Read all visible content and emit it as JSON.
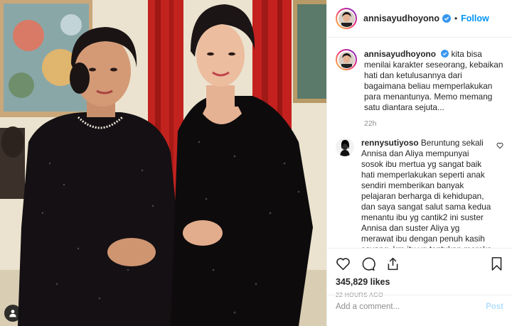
{
  "post": {
    "author": "annisayudhoyono",
    "follow_label": "Follow",
    "separator": "•"
  },
  "caption": {
    "author": "annisayudhoyono",
    "text": "kita bisa menilai karakter seseorang, kebaikan hati dan ketulusannya dari bagaimana beliau memperlakukan para menantunya. Memo memang satu diantara sejuta...",
    "time": "22h"
  },
  "comments": [
    {
      "author": "rennysutiyoso",
      "text": "Beruntung sekali Annisa dan Aliya mempunyai sosok ibu mertua yg sangat baik hati memperlakukan seperti anak sendiri memberikan banyak pelajaran berharga di kehidupan, dan saya sangat salut sama kedua menantu ibu yg cantik2 ini suster Annisa dan suster Aliya yg merawat ibu dengan penuh kasih sayang, krn itu yg tentukan mereka dapatkan dari ibu ani"
    }
  ],
  "stats": {
    "likes": "345,829 likes",
    "time_ago": "22 HOURS AGO"
  },
  "add_comment": {
    "placeholder": "Add a comment...",
    "post_label": "Post"
  },
  "icons": {
    "verified": "verified-badge-icon",
    "like": "heart-icon",
    "comment": "comment-bubble-icon",
    "share": "share-plane-icon",
    "save": "bookmark-icon",
    "tag": "user-tag-icon"
  },
  "colors": {
    "follow_blue": "#0095f6",
    "verified_blue": "#3897f0",
    "post_disabled": "#b2dffc",
    "muted": "#8e8e8e"
  }
}
